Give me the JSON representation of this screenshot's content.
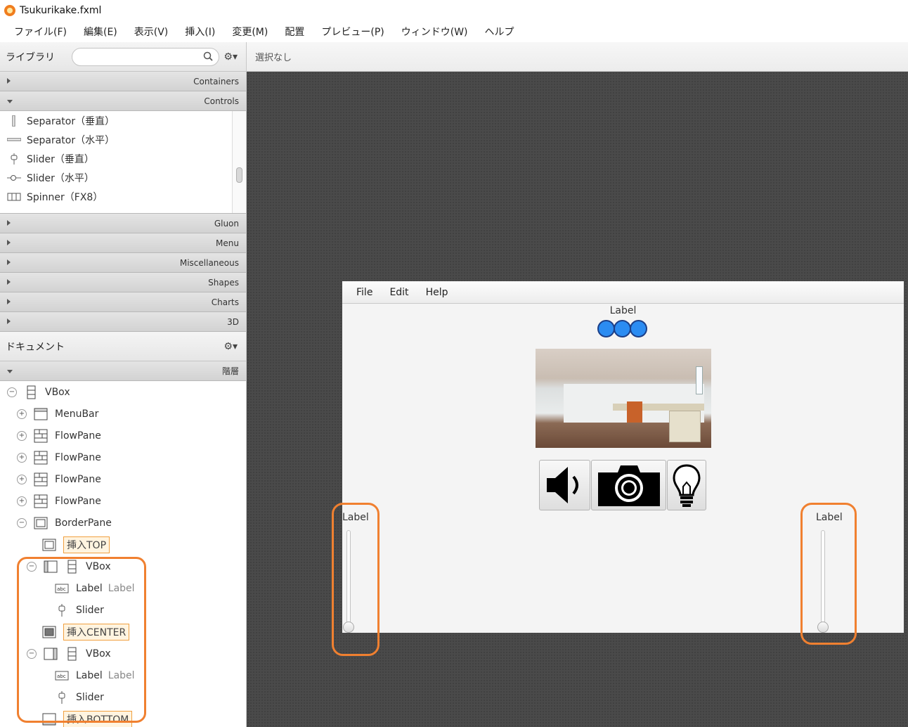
{
  "window": {
    "title": "Tsukurikake.fxml"
  },
  "menubar": {
    "items": [
      "ファイル(F)",
      "編集(E)",
      "表示(V)",
      "挿入(I)",
      "変更(M)",
      "配置",
      "プレビュー(P)",
      "ウィンドウ(W)",
      "ヘルプ"
    ]
  },
  "library": {
    "title": "ライブラリ",
    "search_value": "",
    "sections_before": [
      "Containers"
    ],
    "open_section": "Controls",
    "controls": [
      "Separator（垂直）",
      "Separator（水平）",
      "Slider（垂直）",
      "Slider（水平）",
      "Spinner（FX8）"
    ],
    "sections_after": [
      "Gluon",
      "Menu",
      "Miscellaneous",
      "Shapes",
      "Charts",
      "3D"
    ]
  },
  "document": {
    "title": "ドキュメント",
    "section": "階層",
    "tree": [
      {
        "label": "VBox",
        "toggle": "−",
        "icon": "vbox-icon"
      },
      {
        "label": "MenuBar",
        "toggle": "+",
        "icon": "menubar-icon"
      },
      {
        "label": "FlowPane",
        "toggle": "+",
        "icon": "flowpane-icon"
      },
      {
        "label": "FlowPane",
        "toggle": "+",
        "icon": "flowpane-icon"
      },
      {
        "label": "FlowPane",
        "toggle": "+",
        "icon": "flowpane-icon"
      },
      {
        "label": "FlowPane",
        "toggle": "+",
        "icon": "flowpane-icon"
      },
      {
        "label": "BorderPane",
        "toggle": "−",
        "icon": "borderpane-icon"
      },
      {
        "label": "挿入TOP"
      },
      {
        "label": "VBox",
        "toggle": "−"
      },
      {
        "label": "Label",
        "extra": "Label"
      },
      {
        "label": "Slider"
      },
      {
        "label": "挿入CENTER"
      },
      {
        "label": "VBox",
        "toggle": "−"
      },
      {
        "label": "Label",
        "extra": "Label"
      },
      {
        "label": "Slider"
      },
      {
        "label": "挿入BOTTOM"
      }
    ]
  },
  "content": {
    "status": "選択なし",
    "preview": {
      "menus": [
        "File",
        "Edit",
        "Help"
      ],
      "top_label": "Label",
      "circle_count": 3,
      "left_label": "Label",
      "right_label": "Label",
      "buttons": [
        "speaker-icon",
        "camera-icon",
        "lightbulb-icon"
      ]
    }
  },
  "colors": {
    "accent_orange": "#f08030",
    "circle_blue": "#2b8cf2",
    "canvas": "#4a4a4a"
  }
}
